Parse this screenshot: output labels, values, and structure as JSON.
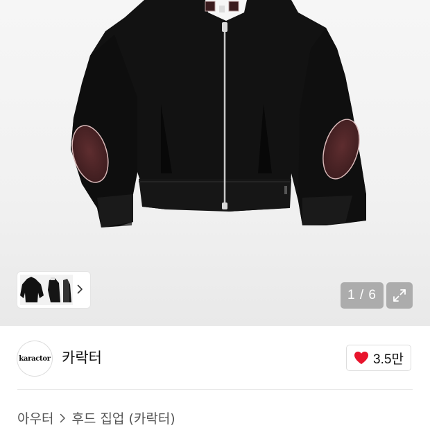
{
  "gallery": {
    "counter": "1 / 6",
    "thumbnail_strip_icon": "chevron-right-icon",
    "expand_icon": "expand-arrows-icon",
    "colors": {
      "background": "#f2f2f2",
      "jacket": "#121212",
      "elbow_patch": "#4a2426",
      "zipper": "#c8c8c8"
    }
  },
  "brand": {
    "logo_text": "karactor",
    "name": "카락터"
  },
  "like": {
    "icon": "heart-icon",
    "count": "3.5만",
    "color": "#e8142c"
  },
  "breadcrumb": {
    "category": "아우터",
    "separator_icon": "chevron-right-icon",
    "subcategory": "후드 집업 (카락터)"
  }
}
